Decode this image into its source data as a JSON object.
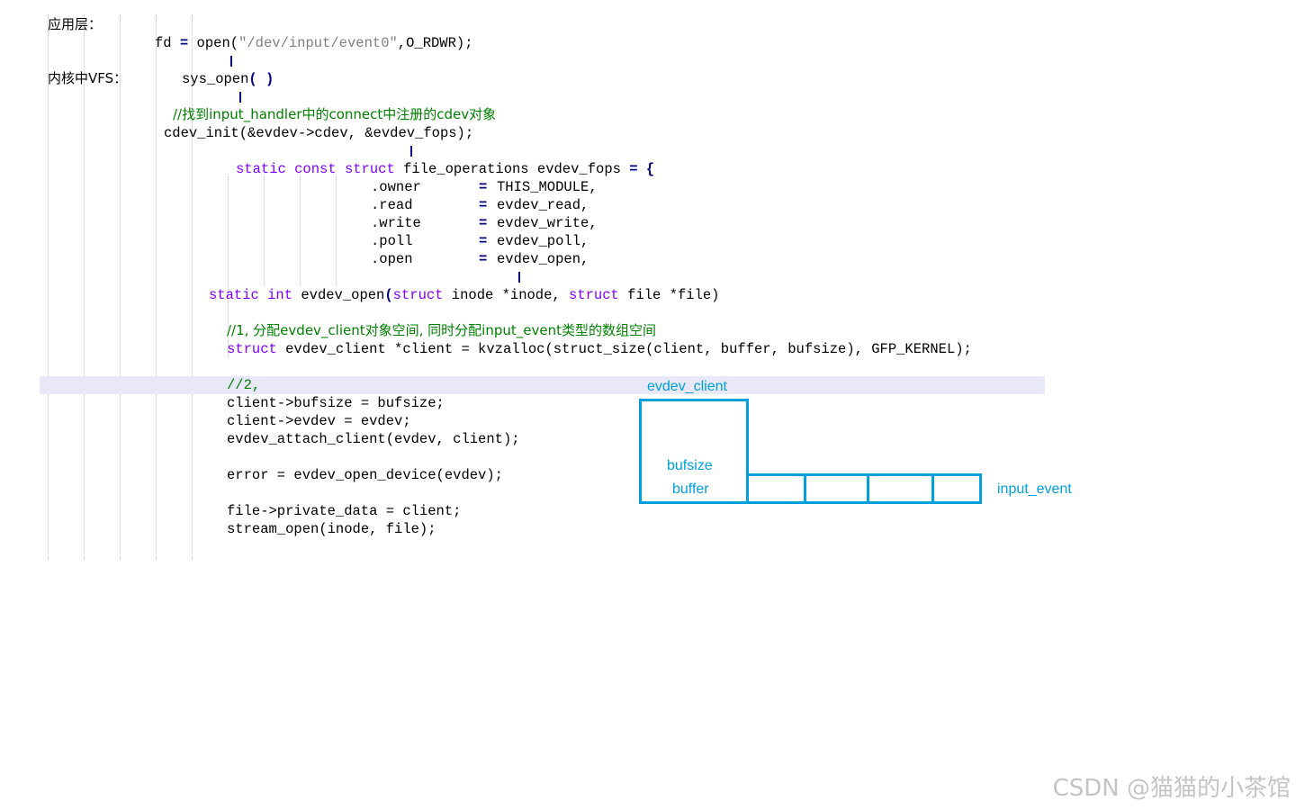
{
  "layers": {
    "app": "应用层：",
    "vfs": "内核中VFS："
  },
  "code": {
    "open_call": {
      "var": "fd",
      "eq": "=",
      "fn": "open(",
      "path": "\"/dev/input/event0\"",
      "rest": ",O_RDWR);"
    },
    "sys_open": {
      "name": "sys_open",
      "parens": "( )"
    },
    "comment_find": "//找到input_handler中的connect中注册的cdev对象",
    "cdev_init": {
      "fn": "cdev_init",
      "args": "(&evdev->cdev, &evdev_fops);"
    },
    "fops_decl": {
      "kw1": "static",
      "kw2": "const",
      "kw3": "struct",
      "type": "file_operations evdev_fops",
      "tail": "= {"
    },
    "fops_fields": [
      {
        "field": ".owner",
        "eq": "=",
        "value": "THIS_MODULE,"
      },
      {
        "field": ".read",
        "eq": "=",
        "value": "evdev_read,"
      },
      {
        "field": ".write",
        "eq": "=",
        "value": "evdev_write,"
      },
      {
        "field": ".poll",
        "eq": "=",
        "value": "evdev_poll,"
      },
      {
        "field": ".open",
        "eq": "=",
        "value": "evdev_open,"
      }
    ],
    "evdev_open_sig": {
      "kw1": "static",
      "kw2": "int",
      "name": "evdev_open",
      "p1kw": "struct",
      "p1": "inode *inode,",
      "p2kw": "struct",
      "p2": "file *file)"
    },
    "comment_1": "//1, 分配evdev_client对象空间, 同时分配input_event类型的数组空间",
    "alloc_line": {
      "kw": "struct",
      "rest": "evdev_client *client = kvzalloc(struct_size(client, buffer, bufsize), GFP_KERNEL);"
    },
    "comment_2": "//2,",
    "body_lines": [
      "client->bufsize = bufsize;",
      "client->evdev = evdev;",
      "evdev_attach_client(evdev, client);",
      "error = evdev_open_device(evdev);",
      "file->private_data = client;",
      "stream_open(inode, file);"
    ]
  },
  "diagram": {
    "struct_label": "evdev_client",
    "field_bufsize": "bufsize",
    "field_buffer": "buffer",
    "array_label": "input_event",
    "array_cells": 4
  },
  "watermark": "CSDN @猫猫的小茶馆",
  "colors": {
    "keyword": "#8000ff",
    "comment": "#008000",
    "string": "#808080",
    "operator": "#000080",
    "diagram": "#00a0dc",
    "highlight": "#e8e8f8"
  }
}
